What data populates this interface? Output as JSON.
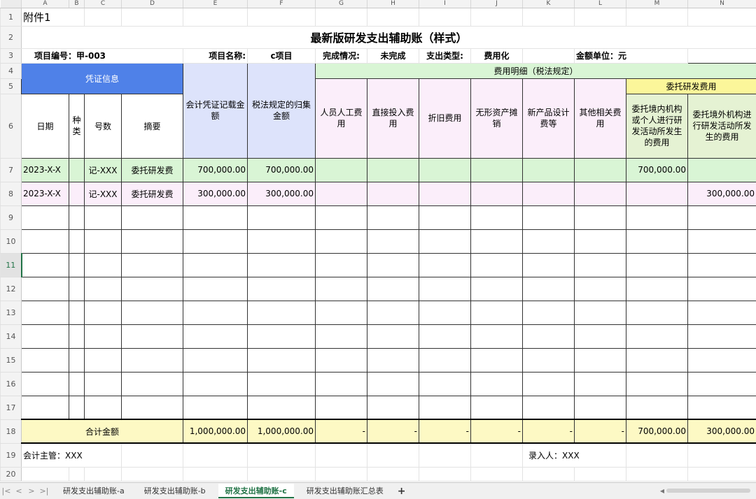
{
  "columns": [
    "A",
    "B",
    "C",
    "D",
    "E",
    "F",
    "G",
    "H",
    "I",
    "J",
    "K",
    "L",
    "M",
    "N"
  ],
  "rows": [
    "1",
    "2",
    "3",
    "4",
    "5",
    "6",
    "7",
    "8",
    "9",
    "10",
    "11",
    "12",
    "13",
    "14",
    "15",
    "16",
    "17",
    "18",
    "19",
    "20"
  ],
  "attachment": "附件1",
  "title": "最新版研发支出辅助账（样式）",
  "info": {
    "project_no_label": "项目编号：甲-003",
    "project_name_label": "项目名称:",
    "project_name_value": "c项目",
    "completion_label": "完成情况:",
    "completion_value": "未完成",
    "expense_type_label": "支出类型:",
    "expense_type_value": "费用化",
    "unit_label": "金额单位：元"
  },
  "headers": {
    "voucher_info": "凭证信息",
    "accounting_amount": "会计凭证记载金额",
    "tax_amount": "税法规定的归集金额",
    "expense_detail": "费用明细（税法规定）",
    "date": "日期",
    "kind": "种类",
    "number": "号数",
    "summary": "摘要",
    "labor": "人员人工费用",
    "direct_input": "直接投入费用",
    "depreciation": "折旧费用",
    "intangible": "无形资产摊销",
    "new_product": "新产品设计费等",
    "other": "其他相关费用",
    "entrusted_rd": "委托研发费用",
    "entrusted_domestic": "委托境内机构或个人进行研发活动所发生的费用",
    "entrusted_foreign": "委托境外机构进行研发活动所发生的费用"
  },
  "records": [
    {
      "date": "2023-X-X",
      "kind": "",
      "number": "记-XXX",
      "summary": "委托研发费",
      "accounting": "700,000.00",
      "tax": "700,000.00",
      "domestic": "700,000.00",
      "foreign": ""
    },
    {
      "date": "2023-X-X",
      "kind": "",
      "number": "记-XXX",
      "summary": "委托研发费",
      "accounting": "300,000.00",
      "tax": "300,000.00",
      "domestic": "",
      "foreign": "300,000.00"
    }
  ],
  "total": {
    "label": "合计金额",
    "accounting": "1,000,000.00",
    "tax": "1,000,000.00",
    "labor": "-",
    "direct_input": "-",
    "depreciation": "-",
    "intangible": "-",
    "new_product": "-",
    "other": "-",
    "domestic": "700,000.00",
    "foreign": "300,000.00"
  },
  "footer": {
    "supervisor": "会计主管：XXX",
    "entry_person": "录入人：XXX"
  },
  "tabs": [
    "研发支出辅助账-a",
    "研发支出辅助账-b",
    "研发支出辅助账-c",
    "研发支出辅助账汇总表"
  ],
  "active_tab_index": 2,
  "add_tab": "+",
  "nav": [
    "|<",
    "<",
    ">",
    ">|"
  ]
}
